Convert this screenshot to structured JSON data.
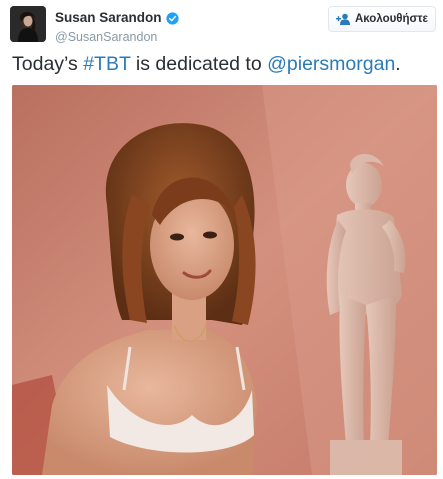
{
  "author": {
    "display_name": "Susan Sarandon",
    "handle": "@SusanSarandon",
    "verified_icon": "verified-badge",
    "avatar_icon": "profile-photo"
  },
  "follow_button": {
    "label": "Ακολουθήστε",
    "icon": "add-user-icon"
  },
  "tweet": {
    "text_before": "Today’s ",
    "hashtag": "#TBT",
    "text_middle": " is dedicated to ",
    "mention": "@piersmorgan",
    "text_after": "."
  },
  "media": {
    "type": "photo"
  },
  "colors": {
    "link": "#2b7bb9",
    "text": "#292f33",
    "muted": "#8899a6",
    "verified": "#1da1f2"
  }
}
